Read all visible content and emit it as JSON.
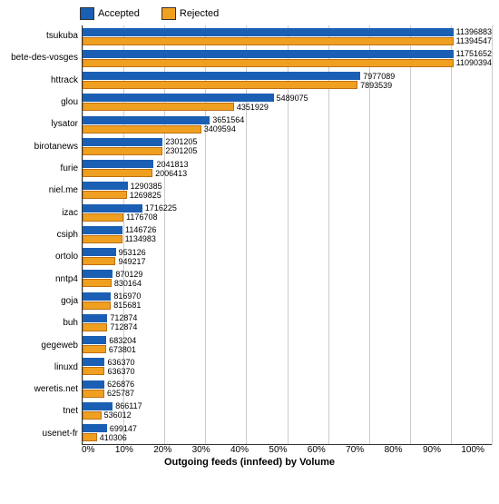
{
  "legend": {
    "accepted_label": "Accepted",
    "rejected_label": "Rejected"
  },
  "x_axis": {
    "title": "Outgoing feeds (innfeed) by Volume",
    "labels": [
      "0%",
      "10%",
      "20%",
      "30%",
      "40%",
      "50%",
      "60%",
      "70%",
      "80%",
      "90%",
      "100%"
    ]
  },
  "bars": [
    {
      "name": "tsukuba",
      "accepted": 11396883,
      "rejected": 11394547,
      "acc_pct": 100,
      "rej_pct": 99.98
    },
    {
      "name": "bete-des-vosges",
      "accepted": 11751652,
      "rejected": 11090394,
      "acc_pct": 100,
      "rej_pct": 94.4
    },
    {
      "name": "httrack",
      "accepted": 7977089,
      "rejected": 7893539,
      "acc_pct": 67.9,
      "rej_pct": 67.2
    },
    {
      "name": "glou",
      "accepted": 5489075,
      "rejected": 4351929,
      "acc_pct": 46.7,
      "rej_pct": 37.0
    },
    {
      "name": "lysator",
      "accepted": 3651564,
      "rejected": 3409594,
      "acc_pct": 31.1,
      "rej_pct": 29.0
    },
    {
      "name": "birotanews",
      "accepted": 2301205,
      "rejected": 2301205,
      "acc_pct": 19.6,
      "rej_pct": 19.6
    },
    {
      "name": "furie",
      "accepted": 2041813,
      "rejected": 2006413,
      "acc_pct": 17.4,
      "rej_pct": 17.1
    },
    {
      "name": "niel.me",
      "accepted": 1290385,
      "rejected": 1269825,
      "acc_pct": 11.0,
      "rej_pct": 10.8
    },
    {
      "name": "izac",
      "accepted": 1716225,
      "rejected": 1176708,
      "acc_pct": 14.6,
      "rej_pct": 10.0
    },
    {
      "name": "csiph",
      "accepted": 1146726,
      "rejected": 1134983,
      "acc_pct": 9.76,
      "rej_pct": 9.66
    },
    {
      "name": "ortolo",
      "accepted": 953126,
      "rejected": 949217,
      "acc_pct": 8.11,
      "rej_pct": 8.08
    },
    {
      "name": "nntp4",
      "accepted": 870129,
      "rejected": 830164,
      "acc_pct": 7.41,
      "rej_pct": 7.07
    },
    {
      "name": "goja",
      "accepted": 816970,
      "rejected": 815681,
      "acc_pct": 6.95,
      "rej_pct": 6.94
    },
    {
      "name": "buh",
      "accepted": 712874,
      "rejected": 712874,
      "acc_pct": 6.07,
      "rej_pct": 6.07
    },
    {
      "name": "gegeweb",
      "accepted": 683204,
      "rejected": 673801,
      "acc_pct": 5.82,
      "rej_pct": 5.73
    },
    {
      "name": "linuxd",
      "accepted": 636370,
      "rejected": 636370,
      "acc_pct": 5.42,
      "rej_pct": 5.42
    },
    {
      "name": "weretis.net",
      "accepted": 626876,
      "rejected": 625787,
      "acc_pct": 5.34,
      "rej_pct": 5.33
    },
    {
      "name": "tnet",
      "accepted": 866117,
      "rejected": 536012,
      "acc_pct": 7.37,
      "rej_pct": 4.56
    },
    {
      "name": "usenet-fr",
      "accepted": 699147,
      "rejected": 410306,
      "acc_pct": 5.95,
      "rej_pct": 3.49
    }
  ],
  "colors": {
    "accepted": "#1a5fb4",
    "rejected": "#f0a020",
    "grid": "#cccccc",
    "axis": "#333333"
  }
}
